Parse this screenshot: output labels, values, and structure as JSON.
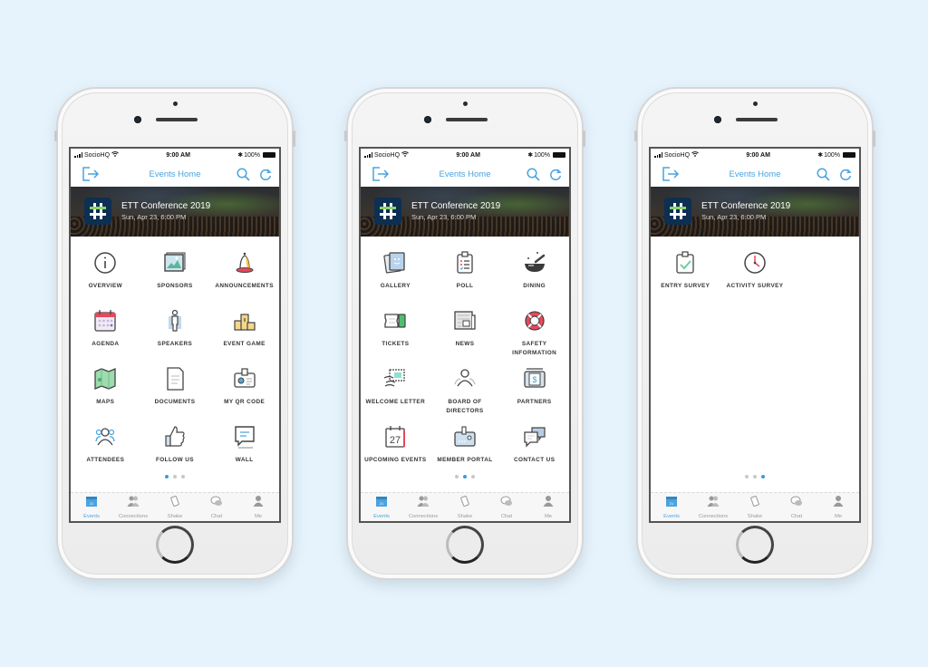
{
  "colors": {
    "accent": "#4aa3df",
    "background": "#e6f3fc",
    "banner_logo": "#0d2f52"
  },
  "status_bar": {
    "carrier": "SocioHQ",
    "time": "9:00 AM",
    "battery": "100%"
  },
  "nav": {
    "title": "Events Home",
    "left_icon": "exit-icon",
    "right_icons": [
      "search-icon",
      "refresh-icon"
    ]
  },
  "event": {
    "title": "ETT Conference 2019",
    "date": "Sun, Apr 23, 6:00 PM",
    "logo_icon": "hashtag-icon"
  },
  "tabbar": [
    {
      "label": "Events",
      "icon": "calendar-icon",
      "active": true
    },
    {
      "label": "Connections",
      "icon": "people-icon"
    },
    {
      "label": "Shake",
      "icon": "shake-phone-icon"
    },
    {
      "label": "Chat",
      "icon": "chat-icon"
    },
    {
      "label": "Me",
      "icon": "person-icon"
    }
  ],
  "screens": [
    {
      "page_index": 1,
      "page_count": 3,
      "tiles": [
        {
          "label": "OVERVIEW",
          "icon": "info-icon"
        },
        {
          "label": "SPONSORS",
          "icon": "picture-icon"
        },
        {
          "label": "ANNOUNCEMENTS",
          "icon": "bell-icon"
        },
        {
          "label": "AGENDA",
          "icon": "calendar-icon"
        },
        {
          "label": "SPEAKERS",
          "icon": "speaker-person-icon"
        },
        {
          "label": "EVENT GAME",
          "icon": "podium-icon"
        },
        {
          "label": "MAPS",
          "icon": "map-icon"
        },
        {
          "label": "DOCUMENTS",
          "icon": "document-icon"
        },
        {
          "label": "MY QR CODE",
          "icon": "id-badge-icon"
        },
        {
          "label": "ATTENDEES",
          "icon": "attendees-icon"
        },
        {
          "label": "FOLLOW US",
          "icon": "thumbs-up-icon"
        },
        {
          "label": "WALL",
          "icon": "message-board-icon"
        }
      ]
    },
    {
      "page_index": 2,
      "page_count": 3,
      "tiles": [
        {
          "label": "GALLERY",
          "icon": "gallery-icon"
        },
        {
          "label": "POLL",
          "icon": "clipboard-list-icon"
        },
        {
          "label": "DINING",
          "icon": "bowl-icon"
        },
        {
          "label": "TICKETS",
          "icon": "ticket-icon"
        },
        {
          "label": "NEWS",
          "icon": "newspaper-icon"
        },
        {
          "label": "SAFETY INFORMATION",
          "icon": "lifebuoy-icon"
        },
        {
          "label": "WELCOME LETTER",
          "icon": "letter-icon"
        },
        {
          "label": "BOARD OF DIRECTORS",
          "icon": "group-icon"
        },
        {
          "label": "PARTNERS",
          "icon": "wallet-icon"
        },
        {
          "label": "UPCOMING EVENTS",
          "icon": "calendar-27-icon"
        },
        {
          "label": "MEMBER PORTAL",
          "icon": "member-card-icon"
        },
        {
          "label": "CONTACT US",
          "icon": "speech-bubbles-icon"
        }
      ]
    },
    {
      "page_index": 3,
      "page_count": 3,
      "tiles": [
        {
          "label": "ENTRY SURVEY",
          "icon": "clipboard-check-icon"
        },
        {
          "label": "ACTIVITY SURVEY",
          "icon": "clock-icon"
        }
      ]
    }
  ]
}
